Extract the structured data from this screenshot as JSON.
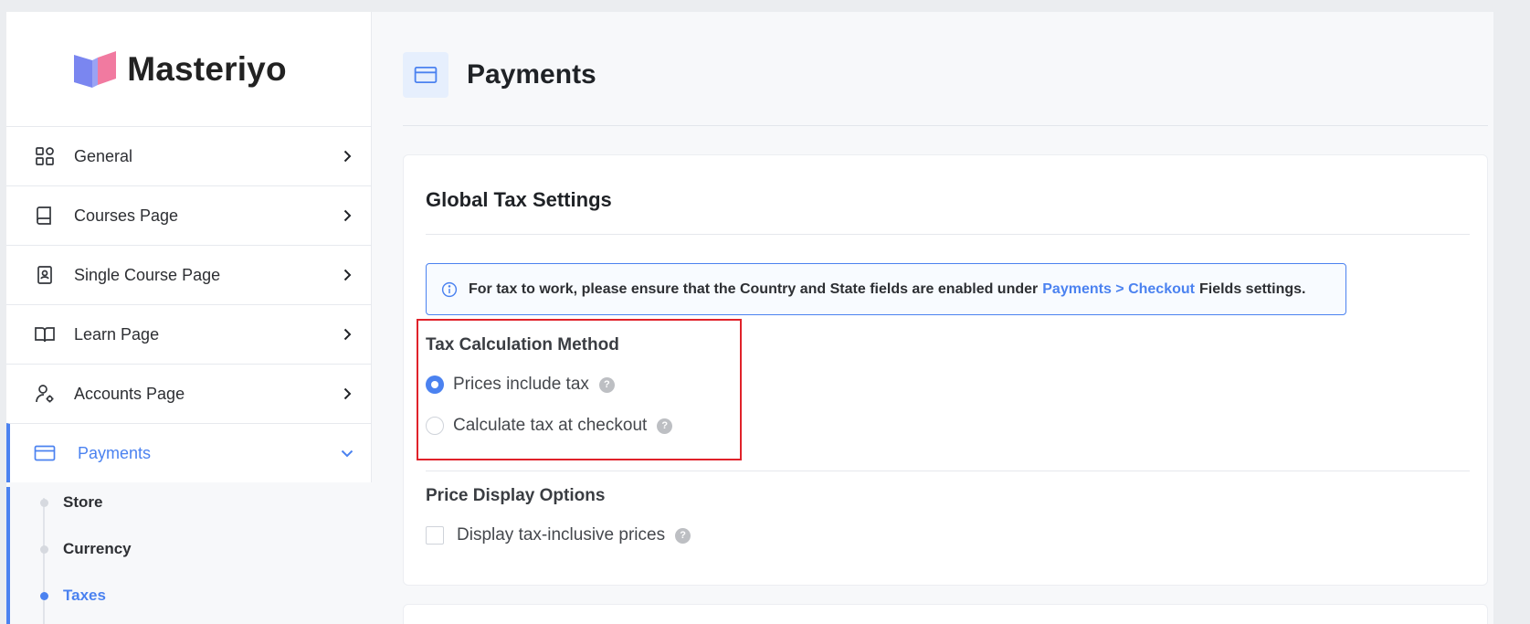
{
  "brand": {
    "name": "Masteriyo"
  },
  "sidebar": {
    "items": [
      {
        "label": "General"
      },
      {
        "label": "Courses Page"
      },
      {
        "label": "Single Course Page"
      },
      {
        "label": "Learn Page"
      },
      {
        "label": "Accounts Page"
      },
      {
        "label": "Payments"
      }
    ],
    "subitems": [
      {
        "label": "Store"
      },
      {
        "label": "Currency"
      },
      {
        "label": "Taxes"
      }
    ]
  },
  "header": {
    "title": "Payments"
  },
  "card": {
    "title": "Global Tax Settings",
    "notice": {
      "before": "For tax to work, please ensure that the Country and State fields are enabled under",
      "link": "Payments > Checkout",
      "after": "Fields settings."
    },
    "tax_method": {
      "label": "Tax Calculation Method",
      "options": [
        {
          "label": "Prices include tax",
          "selected": true
        },
        {
          "label": "Calculate tax at checkout",
          "selected": false
        }
      ]
    },
    "price_display": {
      "label": "Price Display Options",
      "checkbox_label": "Display tax-inclusive prices",
      "checked": false
    },
    "help_glyph": "?"
  },
  "colors": {
    "accent": "#4b82f0",
    "highlight": "#e0222a"
  }
}
